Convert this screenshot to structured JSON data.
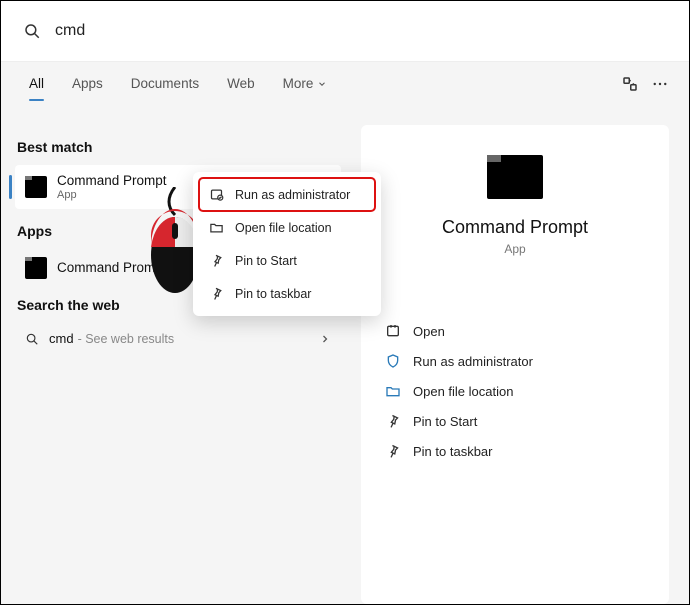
{
  "search": {
    "query": "cmd"
  },
  "tabs": {
    "all": "All",
    "apps": "Apps",
    "documents": "Documents",
    "web": "Web",
    "more": "More"
  },
  "left": {
    "best_h": "Best match",
    "best": {
      "title": "Command Prompt",
      "sub": "App"
    },
    "apps_h": "Apps",
    "apps_item": {
      "title": "Command Prompt"
    },
    "web_h": "Search the web",
    "web_item": {
      "label": "cmd",
      "hint": "- See web results"
    }
  },
  "ctx": {
    "run_admin": "Run as administrator",
    "open_loc": "Open file location",
    "pin_start": "Pin to Start",
    "pin_task": "Pin to taskbar"
  },
  "preview": {
    "title": "Command Prompt",
    "sub": "App",
    "open": "Open",
    "run_admin": "Run as administrator",
    "open_loc": "Open file location",
    "pin_start": "Pin to Start",
    "pin_task": "Pin to taskbar"
  }
}
